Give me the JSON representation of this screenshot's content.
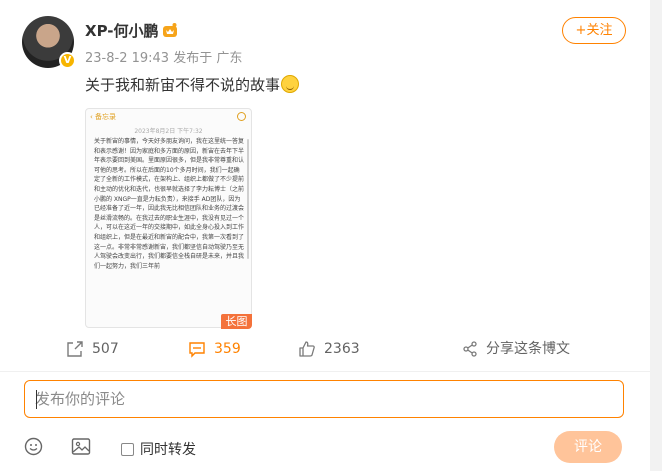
{
  "author": {
    "name": "XP-何小鹏",
    "verified_badge": "V",
    "meta": "23-8-2 19:43  发布于 广东"
  },
  "follow_label": "+关注",
  "post": {
    "text": "关于我和新宙不得不说的故事"
  },
  "image": {
    "app_back": "‹ 备忘录",
    "date": "2023年8月2日 下午7:32",
    "body": "关于新宙的事情，今天好多朋友询问，我在这里统一答复和表示感谢！因为家庭和多方面的原因，新宙在去年下半年表示要回到美国。里面原因很多，但是我非常尊重和认可他的思考。所以在后面的10个多月时间，我们一起确定了全新的工作模式，在架构上、组织上都做了不少提前和主动的优化和迭代，也很早就选择了李力耘博士（之前小鹏的 XNGP一直是力耘负责），来接手 AD团队，因为已经准备了近一年，因此我无比相信团队和业务的过渡会是丝滑流畅的。在我过去的职业生涯中，我没有见过一个人，可以在这近一年的交接期中，如此全身心投入到工作和组织上，但是在最近和新宙的配合中，我第一次看到了这一点。非常非常感谢新宙，我们都坚信自动驾驶乃至无人驾驶会改变出行，我们都要信全栈自研是未来，并且我们一起努力，我们三年前",
    "long_label": "长图"
  },
  "actions": {
    "share_count": "507",
    "comment_count": "359",
    "like_count": "2363",
    "share_weibo_label": "分享这条博文"
  },
  "comment": {
    "placeholder": "发布你的评论",
    "repost_label": "同时转发",
    "submit_label": "评论"
  },
  "colors": {
    "accent": "#ff8200",
    "long_tag": "#f4723b",
    "submit_disabled": "#ffc49a"
  }
}
